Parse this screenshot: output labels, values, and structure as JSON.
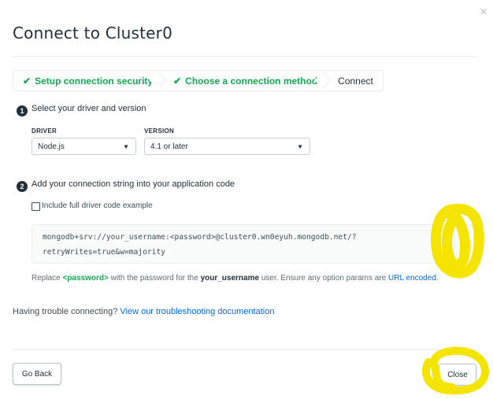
{
  "dialog": {
    "title": "Connect to Cluster0",
    "close_glyph": "×"
  },
  "steps": [
    {
      "label": "Setup connection security",
      "check": "✔",
      "state": "done"
    },
    {
      "label": "Choose a connection method",
      "check": "✔",
      "state": "done"
    },
    {
      "label": "Connect",
      "state": "active"
    }
  ],
  "step1": {
    "number": "1",
    "label": "Select your driver and version",
    "driver_label": "DRIVER",
    "driver_value": "Node.js",
    "version_label": "VERSION",
    "version_value": "4.1 or later",
    "caret": "▼"
  },
  "step2": {
    "number": "2",
    "label": "Add your connection string into your application code",
    "checkbox_label": "Include full driver code example",
    "checkbox_checked": false,
    "connection_line1": "mongodb+srv://your_username:<password>@cluster0.wn0eyuh.mongodb.net/?",
    "connection_line2": "retryWrites=true&w=majority",
    "copy_icon": "copy-icon"
  },
  "replace_note": {
    "prefix": "Replace ",
    "password": "<password>",
    "middle": " with the password for the ",
    "username": "your_username",
    "suffix": " user. Ensure any option params are ",
    "link": "URL encoded."
  },
  "trouble": {
    "text": "Having trouble connecting? ",
    "link": "View our troubleshooting documentation"
  },
  "footer": {
    "back_label": "Go Back",
    "close_label": "Close"
  },
  "colors": {
    "accent_green": "#13aa52",
    "link_blue": "#016bf8",
    "highlight_yellow": "#f5e400"
  }
}
